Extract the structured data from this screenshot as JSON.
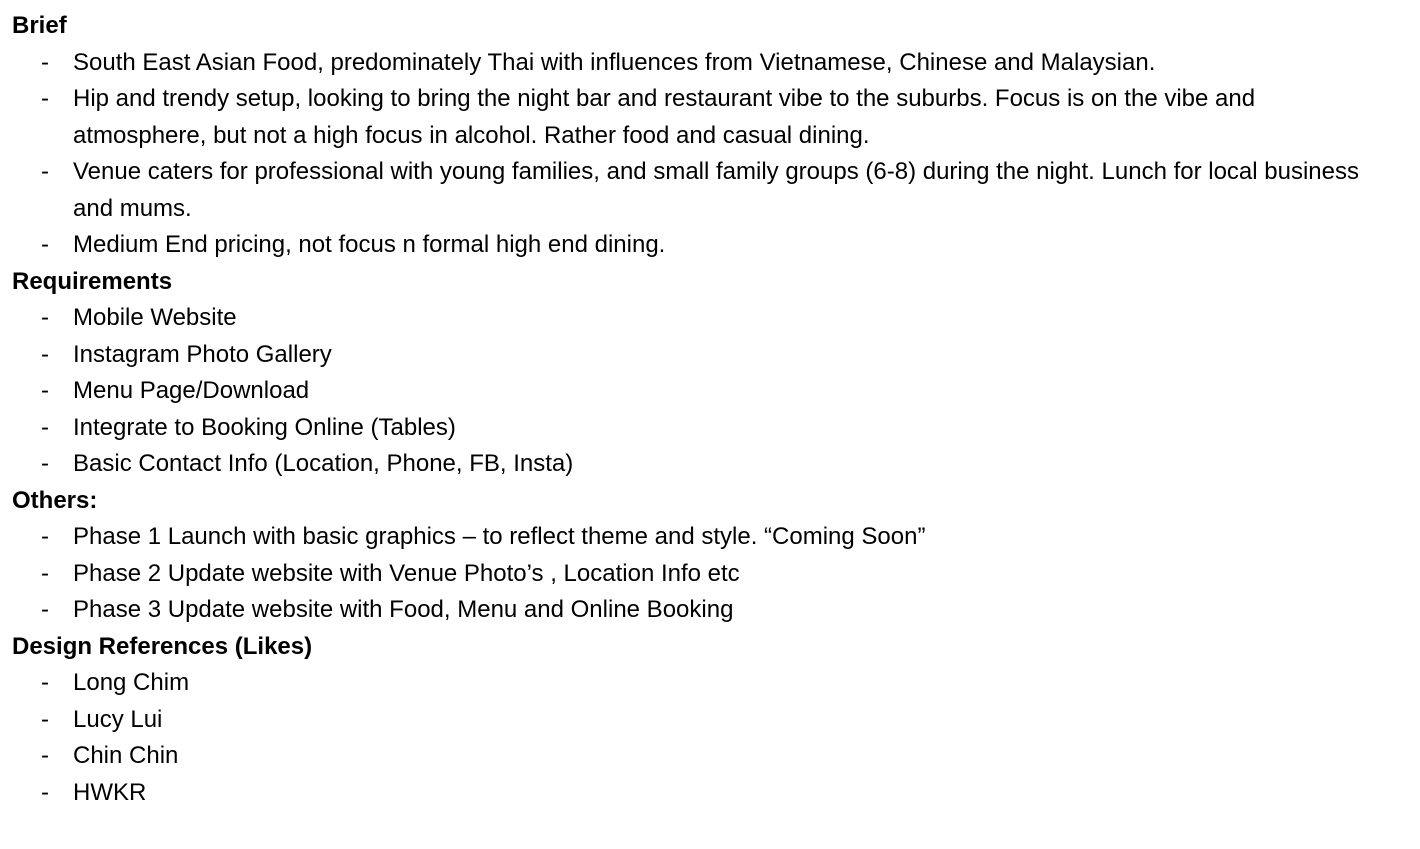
{
  "sections": [
    {
      "heading": "Brief",
      "items": [
        "South East Asian Food, predominately Thai with influences from Vietnamese, Chinese and Malaysian.",
        "Hip and trendy setup, looking to bring the night bar and restaurant vibe to the suburbs.  Focus is on the vibe and atmosphere, but not a high focus in alcohol. Rather food and casual dining.",
        "Venue caters for professional with young families, and small family groups (6-8) during the night. Lunch for local business and mums.",
        "Medium End pricing,  not focus n formal high end dining."
      ]
    },
    {
      "heading": "Requirements",
      "items": [
        "Mobile Website",
        "Instagram Photo Gallery",
        "Menu Page/Download",
        "Integrate to Booking Online (Tables)",
        "Basic Contact Info (Location, Phone, FB, Insta)"
      ]
    },
    {
      "heading": "Others:",
      "items": [
        "Phase 1 Launch with basic graphics – to reflect theme and style. “Coming Soon”",
        "Phase 2 Update website with Venue Photo’s , Location Info etc",
        "Phase 3 Update website with Food, Menu and Online Booking"
      ]
    },
    {
      "heading": "Design References (Likes)",
      "items": [
        "Long Chim",
        "Lucy Lui",
        "Chin Chin",
        "HWKR"
      ]
    }
  ],
  "bullet_marker": "-"
}
